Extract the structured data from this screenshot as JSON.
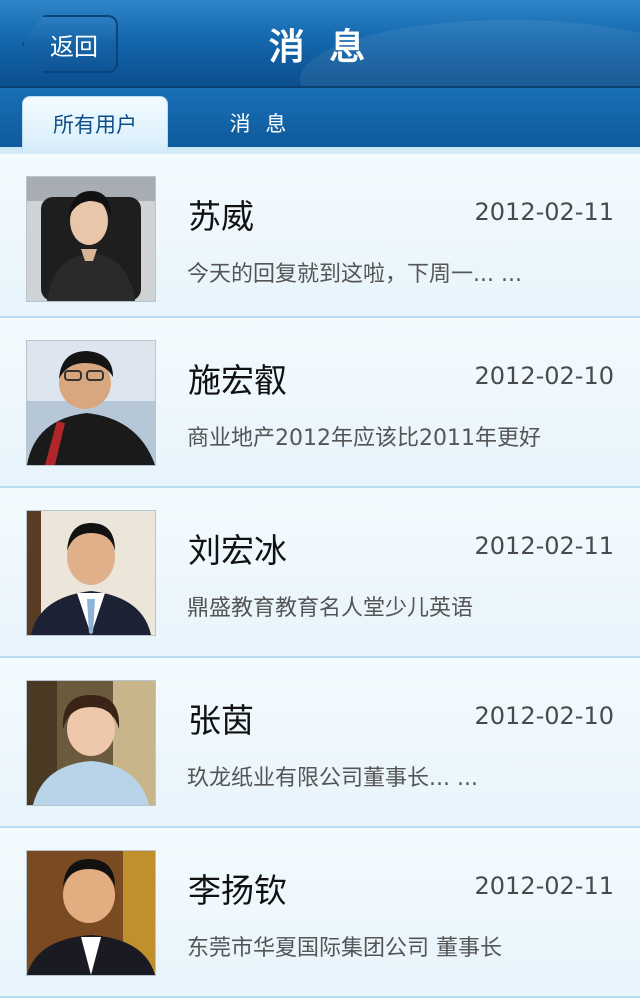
{
  "header": {
    "back_label": "返回",
    "title": "消 息"
  },
  "tabs": [
    {
      "label": "所有用户",
      "active": true
    },
    {
      "label": "消 息",
      "active": false
    }
  ],
  "messages": [
    {
      "name": "苏威",
      "date": "2012-02-11",
      "preview": "今天的回复就到这啦，下周一... ..."
    },
    {
      "name": "施宏叡",
      "date": "2012-02-10",
      "preview": "商业地产2012年应该比2011年更好"
    },
    {
      "name": "刘宏冰",
      "date": "2012-02-11",
      "preview": "鼎盛教育教育名人堂少儿英语"
    },
    {
      "name": "张茵",
      "date": "2012-02-10",
      "preview": "玖龙纸业有限公司董事长... ..."
    },
    {
      "name": "李扬钦",
      "date": "2012-02-11",
      "preview": "东莞市华夏国际集团公司 董事长"
    }
  ],
  "colors": {
    "header_blue": "#1467ad",
    "row_background": "#eef8fd",
    "separator": "#b7dcef"
  }
}
